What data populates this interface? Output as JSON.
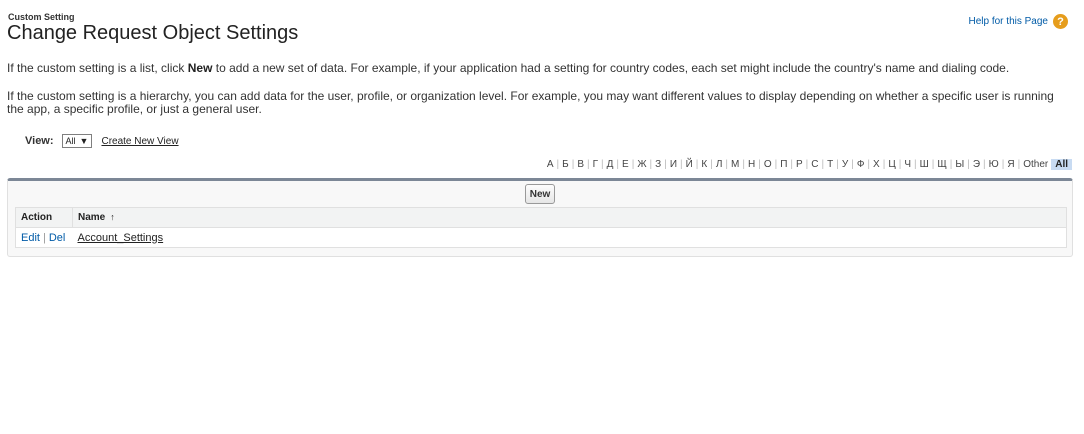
{
  "header": {
    "kicker": "Custom Setting",
    "title": "Change Request Object Settings",
    "help_link": "Help for this Page",
    "help_icon": "?"
  },
  "description": {
    "p1_before": "If the custom setting is a list, click ",
    "p1_bold": "New",
    "p1_after": " to add a new set of data. For example, if your application had a setting for country codes, each set might include the country's name and dialing code.",
    "p2": "If the custom setting is a hierarchy, you can add data for the user, profile, or organization level. For example, you may want different values to display depending on whether a specific user is running the app, a specific profile, or just a general user."
  },
  "view": {
    "label": "View:",
    "selected": "All",
    "dropdown_icon": "▼",
    "create_link": "Create New View"
  },
  "alphabet": [
    "А",
    "Б",
    "В",
    "Г",
    "Д",
    "Е",
    "Ж",
    "З",
    "И",
    "Й",
    "К",
    "Л",
    "М",
    "Н",
    "О",
    "П",
    "Р",
    "С",
    "Т",
    "У",
    "Ф",
    "Х",
    "Ц",
    "Ч",
    "Ш",
    "Щ",
    "Ы",
    "Э",
    "Ю",
    "Я",
    "Other",
    "All"
  ],
  "alphabet_selected": "All",
  "toolbar": {
    "new_label": "New"
  },
  "table": {
    "headers": {
      "action": "Action",
      "name": "Name",
      "sort_icon": "↑"
    },
    "rows": [
      {
        "edit": "Edit",
        "sep": "|",
        "del": "Del",
        "name": "Account_Settings"
      }
    ]
  },
  "colors": {
    "link": "#015ba7",
    "help_icon": "#e69d1c",
    "selected_letter": "#c8dbf2",
    "panel_border": "#7c8796"
  }
}
